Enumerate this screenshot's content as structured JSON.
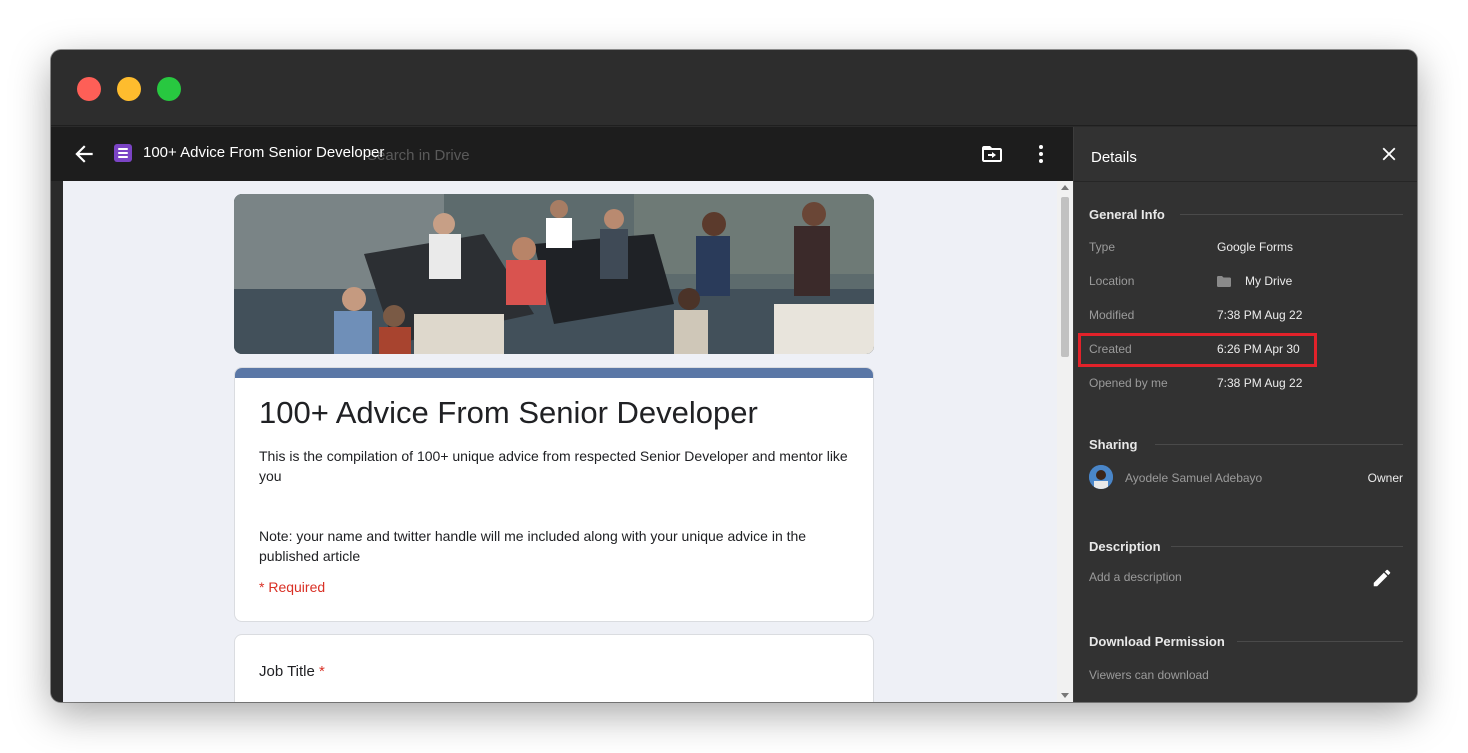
{
  "viewer": {
    "ghost_search": "Search in Drive",
    "doc_title": "100+ Advice From Senior Developer"
  },
  "form": {
    "title": "100+ Advice From Senior Developer",
    "description": "This is the compilation of 100+ unique advice from respected Senior Developer and mentor like you",
    "note": "Note: your name and twitter handle will me included along with your unique advice in the published article",
    "required_note": "* Required",
    "question_label": "Job Title",
    "required_star": "*"
  },
  "details": {
    "title": "Details",
    "general_info": {
      "heading": "General Info",
      "rows": [
        {
          "label": "Type",
          "value": "Google Forms"
        },
        {
          "label": "Location",
          "value": "My Drive"
        },
        {
          "label": "Modified",
          "value": "7:38 PM Aug 22"
        },
        {
          "label": "Created",
          "value": "6:26 PM Apr 30"
        },
        {
          "label": "Opened by me",
          "value": "7:38 PM Aug 22"
        }
      ]
    },
    "sharing": {
      "heading": "Sharing",
      "owner_name": "Ayodele Samuel Adebayo",
      "owner_role": "Owner"
    },
    "description": {
      "heading": "Description",
      "placeholder": "Add a description"
    },
    "download": {
      "heading": "Download Permission",
      "text": "Viewers can download"
    }
  },
  "colors": {
    "accent_bar": "#5a77a6",
    "highlight": "#e2222a",
    "required": "#d93025",
    "forms_brand": "#7b44c5"
  },
  "icons": [
    "back-arrow-icon",
    "google-forms-icon",
    "move-to-folder-icon",
    "more-vertical-icon",
    "close-icon",
    "folder-icon",
    "pencil-icon"
  ]
}
